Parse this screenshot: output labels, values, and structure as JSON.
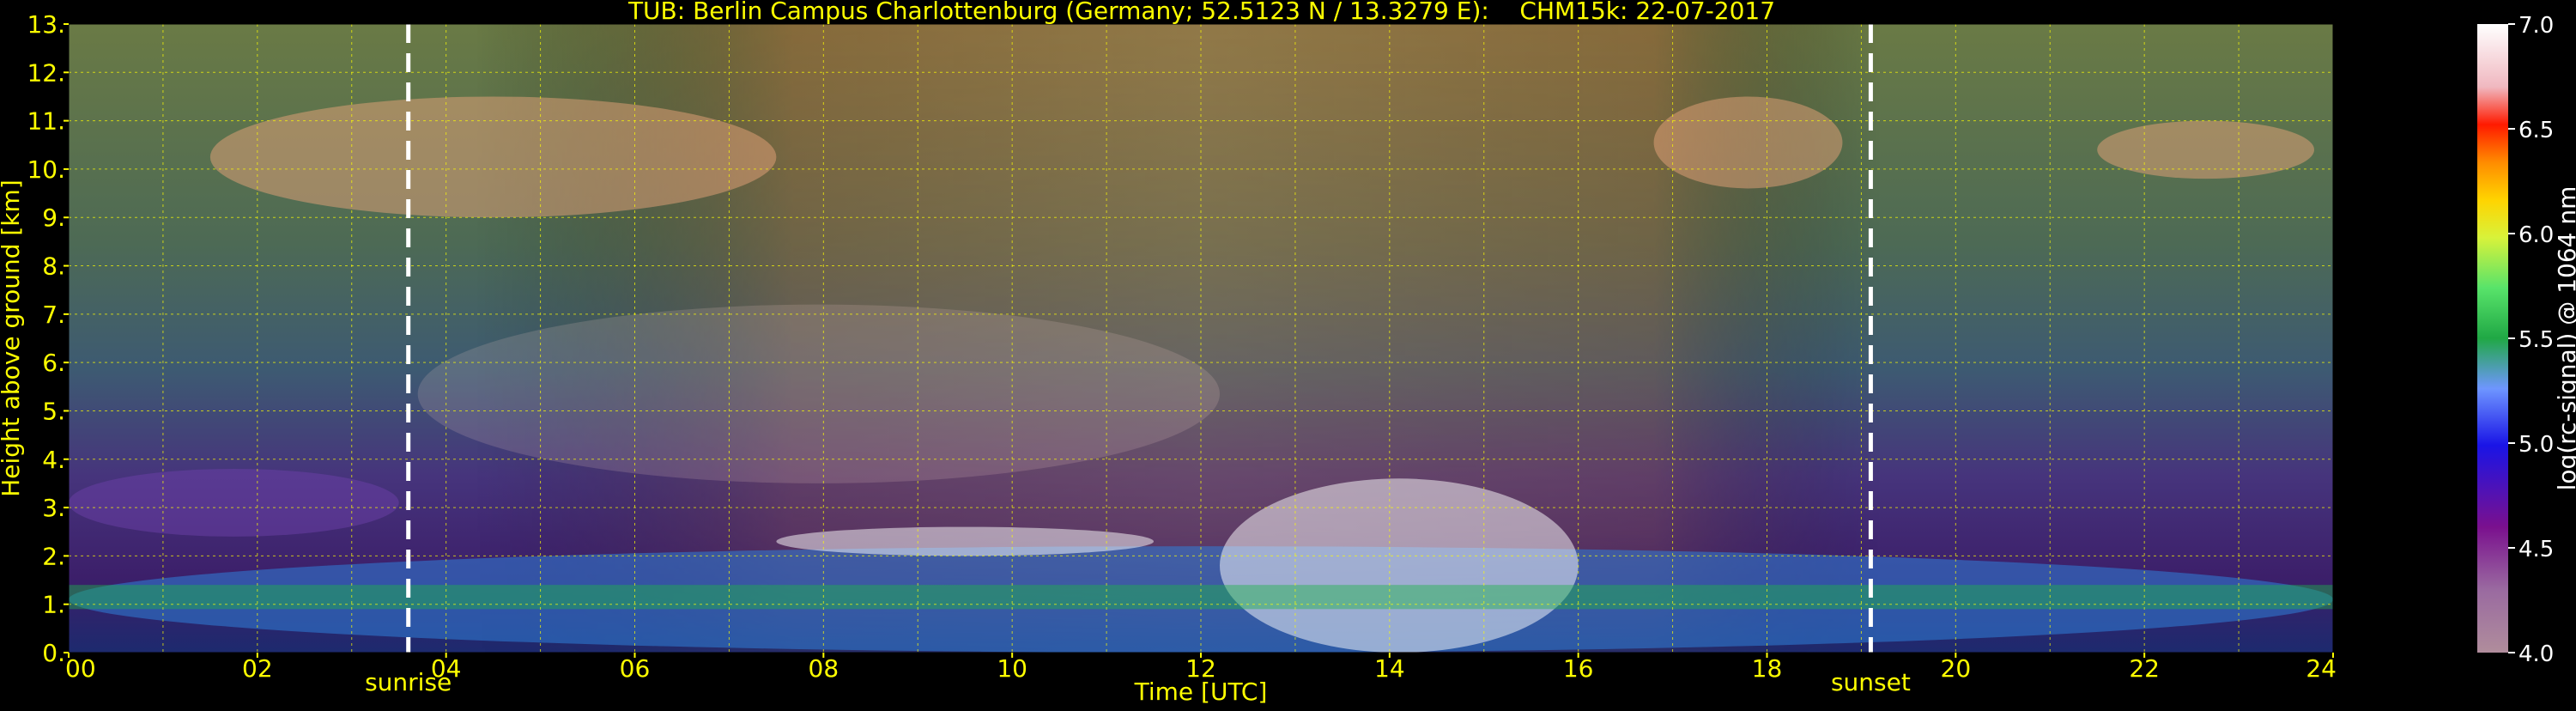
{
  "chart_data": {
    "type": "heatmap",
    "title": "TUB: Berlin Campus Charlottenburg (Germany; 52.5123 N / 13.3279 E):    CHM15k: 22-07-2017",
    "xlabel": "Time [UTC]",
    "ylabel": "Height above ground [km]",
    "xlim": [
      0,
      24
    ],
    "ylim": [
      0,
      13
    ],
    "x_ticks": [
      "00",
      "02",
      "04",
      "06",
      "08",
      "10",
      "12",
      "14",
      "16",
      "18",
      "20",
      "22",
      "24"
    ],
    "y_ticks": [
      "0.",
      "1.",
      "2.",
      "3.",
      "4.",
      "5.",
      "6.",
      "7.",
      "8.",
      "9.",
      "10.",
      "11.",
      "12.",
      "13."
    ],
    "grid": true,
    "colorbar": {
      "label": "log(rc-signal) @ 1064 nm",
      "range": [
        4.0,
        7.0
      ],
      "tick_labels": [
        "4.0",
        "4.5",
        "5.0",
        "5.5",
        "6.0",
        "6.5",
        "7.0"
      ]
    },
    "vertical_markers": [
      {
        "label": "sunrise",
        "time_utc": 3.6
      },
      {
        "label": "sunset",
        "time_utc": 19.1
      }
    ],
    "features": [
      {
        "kind": "boundary-layer aerosol",
        "t0": 0,
        "t1": 24,
        "h0": 0,
        "h1": 2.2
      },
      {
        "kind": "residual layer",
        "t0": 0,
        "t1": 3.5,
        "h0": 2.4,
        "h1": 3.8
      },
      {
        "kind": "cirrus",
        "t0": 1.5,
        "t1": 7.5,
        "h0": 9.0,
        "h1": 11.5
      },
      {
        "kind": "cirrus",
        "t0": 16.8,
        "t1": 18.8,
        "h0": 9.6,
        "h1": 11.5
      },
      {
        "kind": "cirrus",
        "t0": 21.5,
        "t1": 23.8,
        "h0": 9.8,
        "h1": 11.0
      },
      {
        "kind": "cumulus tops",
        "t0": 7.5,
        "t1": 11.5,
        "h0": 2.0,
        "h1": 2.6
      },
      {
        "kind": "convective cloud",
        "t0": 12.2,
        "t1": 16.0,
        "h0": 0,
        "h1": 3.6
      },
      {
        "kind": "mid-level cloud",
        "t0": 3.7,
        "t1": 12.2,
        "h0": 3.5,
        "h1": 7.2
      }
    ],
    "colors": {
      "axis_text": "#ffff00",
      "grid": "#ffff00",
      "markers": "#ffffff",
      "background": "#000000"
    }
  }
}
